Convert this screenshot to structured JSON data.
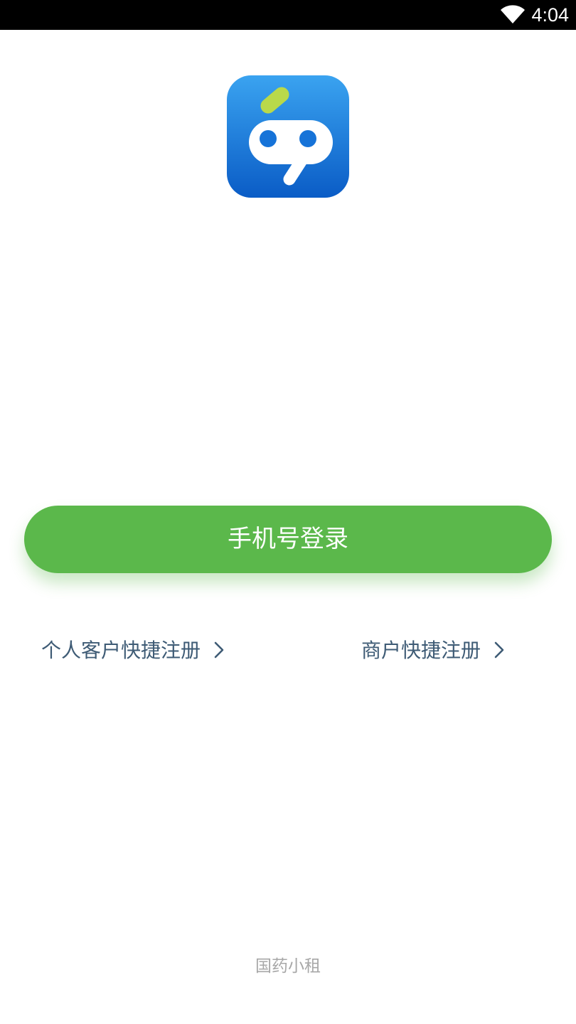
{
  "status_bar": {
    "time": "4:04",
    "wifi_icon": "wifi-icon"
  },
  "logo": {
    "icon": "robot-face-logo",
    "colors": {
      "background_top": "#3aa3f0",
      "background_bottom": "#0a5cc6",
      "accent": "#b9d94a",
      "face": "#ffffff"
    }
  },
  "login_button": {
    "label": "手机号登录",
    "color": "#5bb84b"
  },
  "register": {
    "personal_label": "个人客户快捷注册",
    "merchant_label": "商户快捷注册",
    "arrow_icon": "chevron-right-icon",
    "color": "#3e5b75"
  },
  "footer": {
    "brand": "国药小租"
  }
}
